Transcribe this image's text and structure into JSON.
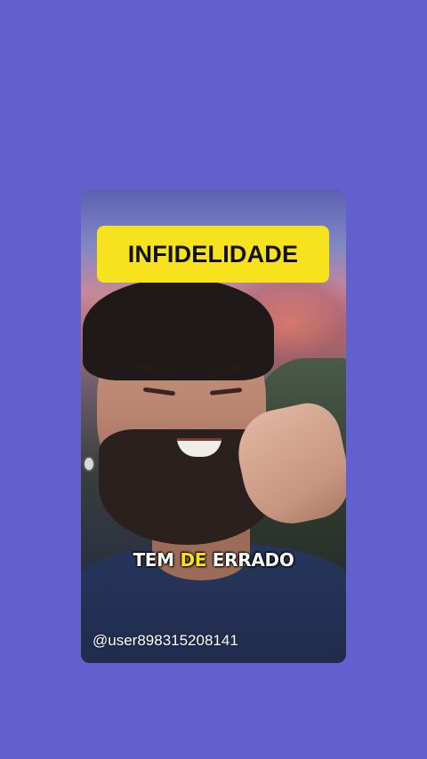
{
  "colors": {
    "background": "#6260cf",
    "banner": "#f8e11d",
    "caption_highlight": "#f8e11d",
    "caption_text": "#ffffff"
  },
  "video": {
    "title_banner": "INFIDELIDADE",
    "caption": {
      "word1": "TEM",
      "word2": "DE",
      "word3": "ERRADO"
    },
    "username": "@user898315208141"
  }
}
